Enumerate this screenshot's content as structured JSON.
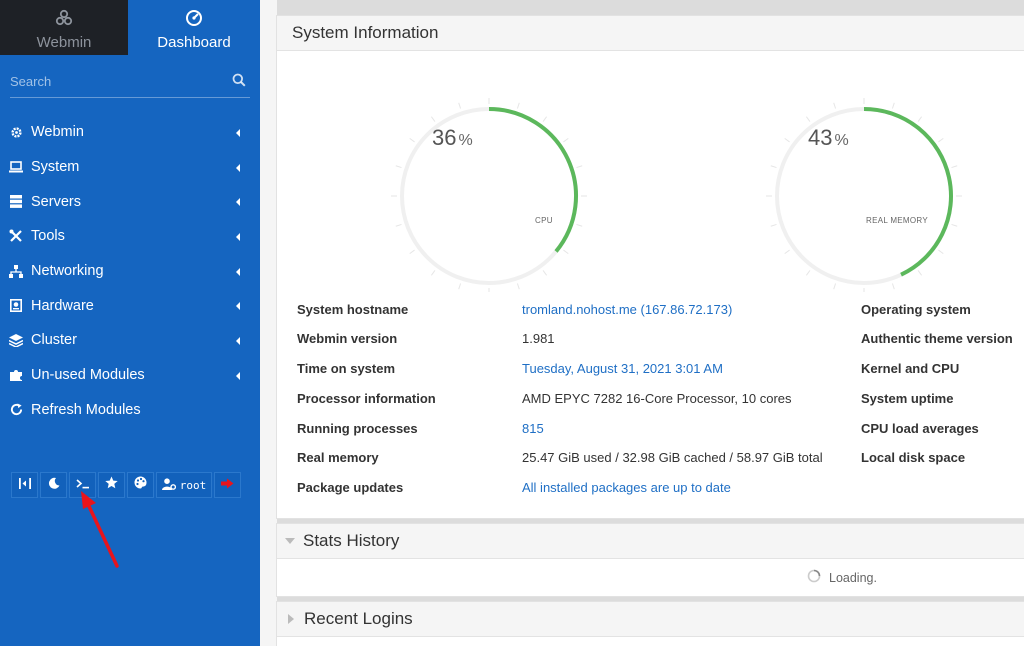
{
  "sidebar": {
    "tabs": [
      {
        "label": "Webmin",
        "icon": "webmin-logo-icon"
      },
      {
        "label": "Dashboard",
        "icon": "dashboard-gauge-icon"
      }
    ],
    "search": {
      "placeholder": "Search",
      "value": ""
    },
    "menu": [
      {
        "label": "Webmin",
        "icon": "gear-icon"
      },
      {
        "label": "System",
        "icon": "laptop-icon"
      },
      {
        "label": "Servers",
        "icon": "server-rack-icon"
      },
      {
        "label": "Tools",
        "icon": "tools-icon"
      },
      {
        "label": "Networking",
        "icon": "network-icon"
      },
      {
        "label": "Hardware",
        "icon": "hard-drive-icon"
      },
      {
        "label": "Cluster",
        "icon": "layers-icon"
      },
      {
        "label": "Un-used Modules",
        "icon": "puzzle-icon"
      },
      {
        "label": "Refresh Modules",
        "icon": "refresh-icon"
      }
    ],
    "toolbar": {
      "user_label": "root",
      "buttons": [
        "collapse-sidebar-icon",
        "moon-icon",
        "terminal-icon",
        "star-icon",
        "palette-icon",
        "user-gear-icon",
        "logout-icon"
      ]
    }
  },
  "system_info": {
    "title": "System Information",
    "gauges": [
      {
        "value": "36",
        "unit": "%",
        "caption": "CPU",
        "fraction": 0.36
      },
      {
        "value": "43",
        "unit": "%",
        "caption": "REAL MEMORY",
        "fraction": 0.43
      }
    ],
    "left_rows": [
      {
        "key": "System hostname",
        "value": "tromland.nohost.me (167.86.72.173)",
        "link": true
      },
      {
        "key": "Webmin version",
        "value": "1.981",
        "link": false
      },
      {
        "key": "Time on system",
        "value": "Tuesday, August 31, 2021 3:01 AM",
        "link": true
      },
      {
        "key": "Processor information",
        "value": "AMD EPYC 7282 16-Core Processor, 10 cores",
        "link": false
      },
      {
        "key": "Running processes",
        "value": "815",
        "link": true
      },
      {
        "key": "Real memory",
        "value": "25.47 GiB used / 32.98 GiB cached / 58.97 GiB total",
        "link": false
      },
      {
        "key": "Package updates",
        "value": "All installed packages are up to date",
        "link": true
      }
    ],
    "right_rows": [
      {
        "key": "Operating system"
      },
      {
        "key": "Authentic theme version"
      },
      {
        "key": "Kernel and CPU"
      },
      {
        "key": "System uptime"
      },
      {
        "key": "CPU load averages"
      },
      {
        "key": "Local disk space"
      }
    ]
  },
  "stats_history": {
    "title": "Stats History",
    "loading_text": "Loading."
  },
  "recent_logins": {
    "title": "Recent Logins"
  },
  "colors": {
    "sidebar": "#1565c0",
    "gauge": "#5cb85c",
    "link": "#1f6fc5",
    "annotation_arrow": "#e8141c"
  }
}
